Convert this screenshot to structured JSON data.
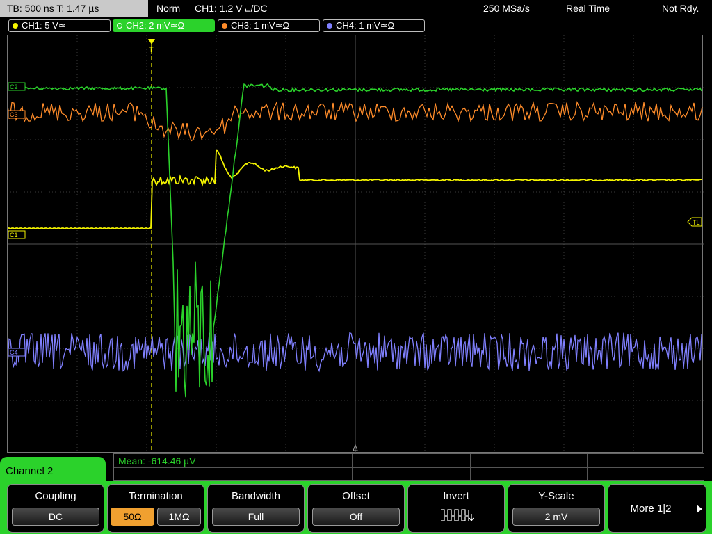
{
  "top_bar": {
    "timebase": "TB: 500 ns  T: 1.47 µs",
    "mode": "Norm",
    "trigger": "CH1: 1.2 V ⨽/DC",
    "sample_rate": "250 MSa/s",
    "acq_mode": "Real Time",
    "status": "Not Rdy."
  },
  "channels": [
    {
      "label": "CH1: 5 V≃",
      "color": "#f5f500"
    },
    {
      "label": "CH2: 2 mV≃Ω",
      "color": "#2bd22b"
    },
    {
      "label": "CH3: 1 mV≃Ω",
      "color": "#ff8c2a"
    },
    {
      "label": "CH4: 1 mV≃Ω",
      "color": "#8080ff"
    }
  ],
  "markers": {
    "trig_level": "TL",
    "ch1": "C1",
    "ch2": "C2",
    "ch3": "C3",
    "ch4": "C4",
    "trigger_pos": "T"
  },
  "measurement": {
    "text": "Mean: -614.46 µV"
  },
  "channel_tab": {
    "label": "Channel 2"
  },
  "softkeys": {
    "coupling": {
      "title": "Coupling",
      "value": "DC"
    },
    "termination": {
      "title": "Termination",
      "opt1": "50Ω",
      "opt2": "1MΩ"
    },
    "bandwidth": {
      "title": "Bandwidth",
      "value": "Full"
    },
    "offset": {
      "title": "Offset",
      "value": "Off"
    },
    "invert": {
      "title": "Invert"
    },
    "yscale": {
      "title": "Y-Scale",
      "value": "2 mV"
    },
    "more": {
      "title": "More 1|2"
    }
  }
}
